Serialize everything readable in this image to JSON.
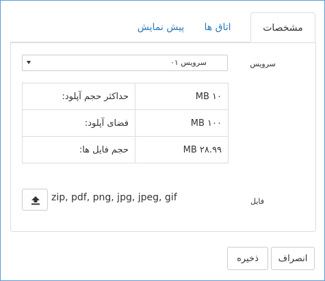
{
  "tabs": [
    {
      "label": "مشخصات",
      "active": true
    },
    {
      "label": "اتاق ها",
      "active": false
    },
    {
      "label": "پیش نمایش",
      "active": false
    }
  ],
  "service": {
    "label": "سرویس",
    "selected": "سرویس ۰۱"
  },
  "info_rows": [
    {
      "key": "حداکثر حجم آپلود:",
      "value": "MB ۱۰"
    },
    {
      "key": "فضای آپلود:",
      "value": "MB ۱۰۰"
    },
    {
      "key": "حجم فایل ها:",
      "value": "MB ۲۸.۹۹"
    }
  ],
  "file": {
    "label": "فایل",
    "allowed_extensions": "zip, pdf, png, jpg, jpeg, gif",
    "icon": "upload-icon"
  },
  "footer": {
    "cancel_label": "انصراف",
    "save_label": "ذخیره"
  },
  "colors": {
    "link": "#2a7ab8",
    "border": "#dddddd",
    "frame": "#5b9bd5"
  }
}
